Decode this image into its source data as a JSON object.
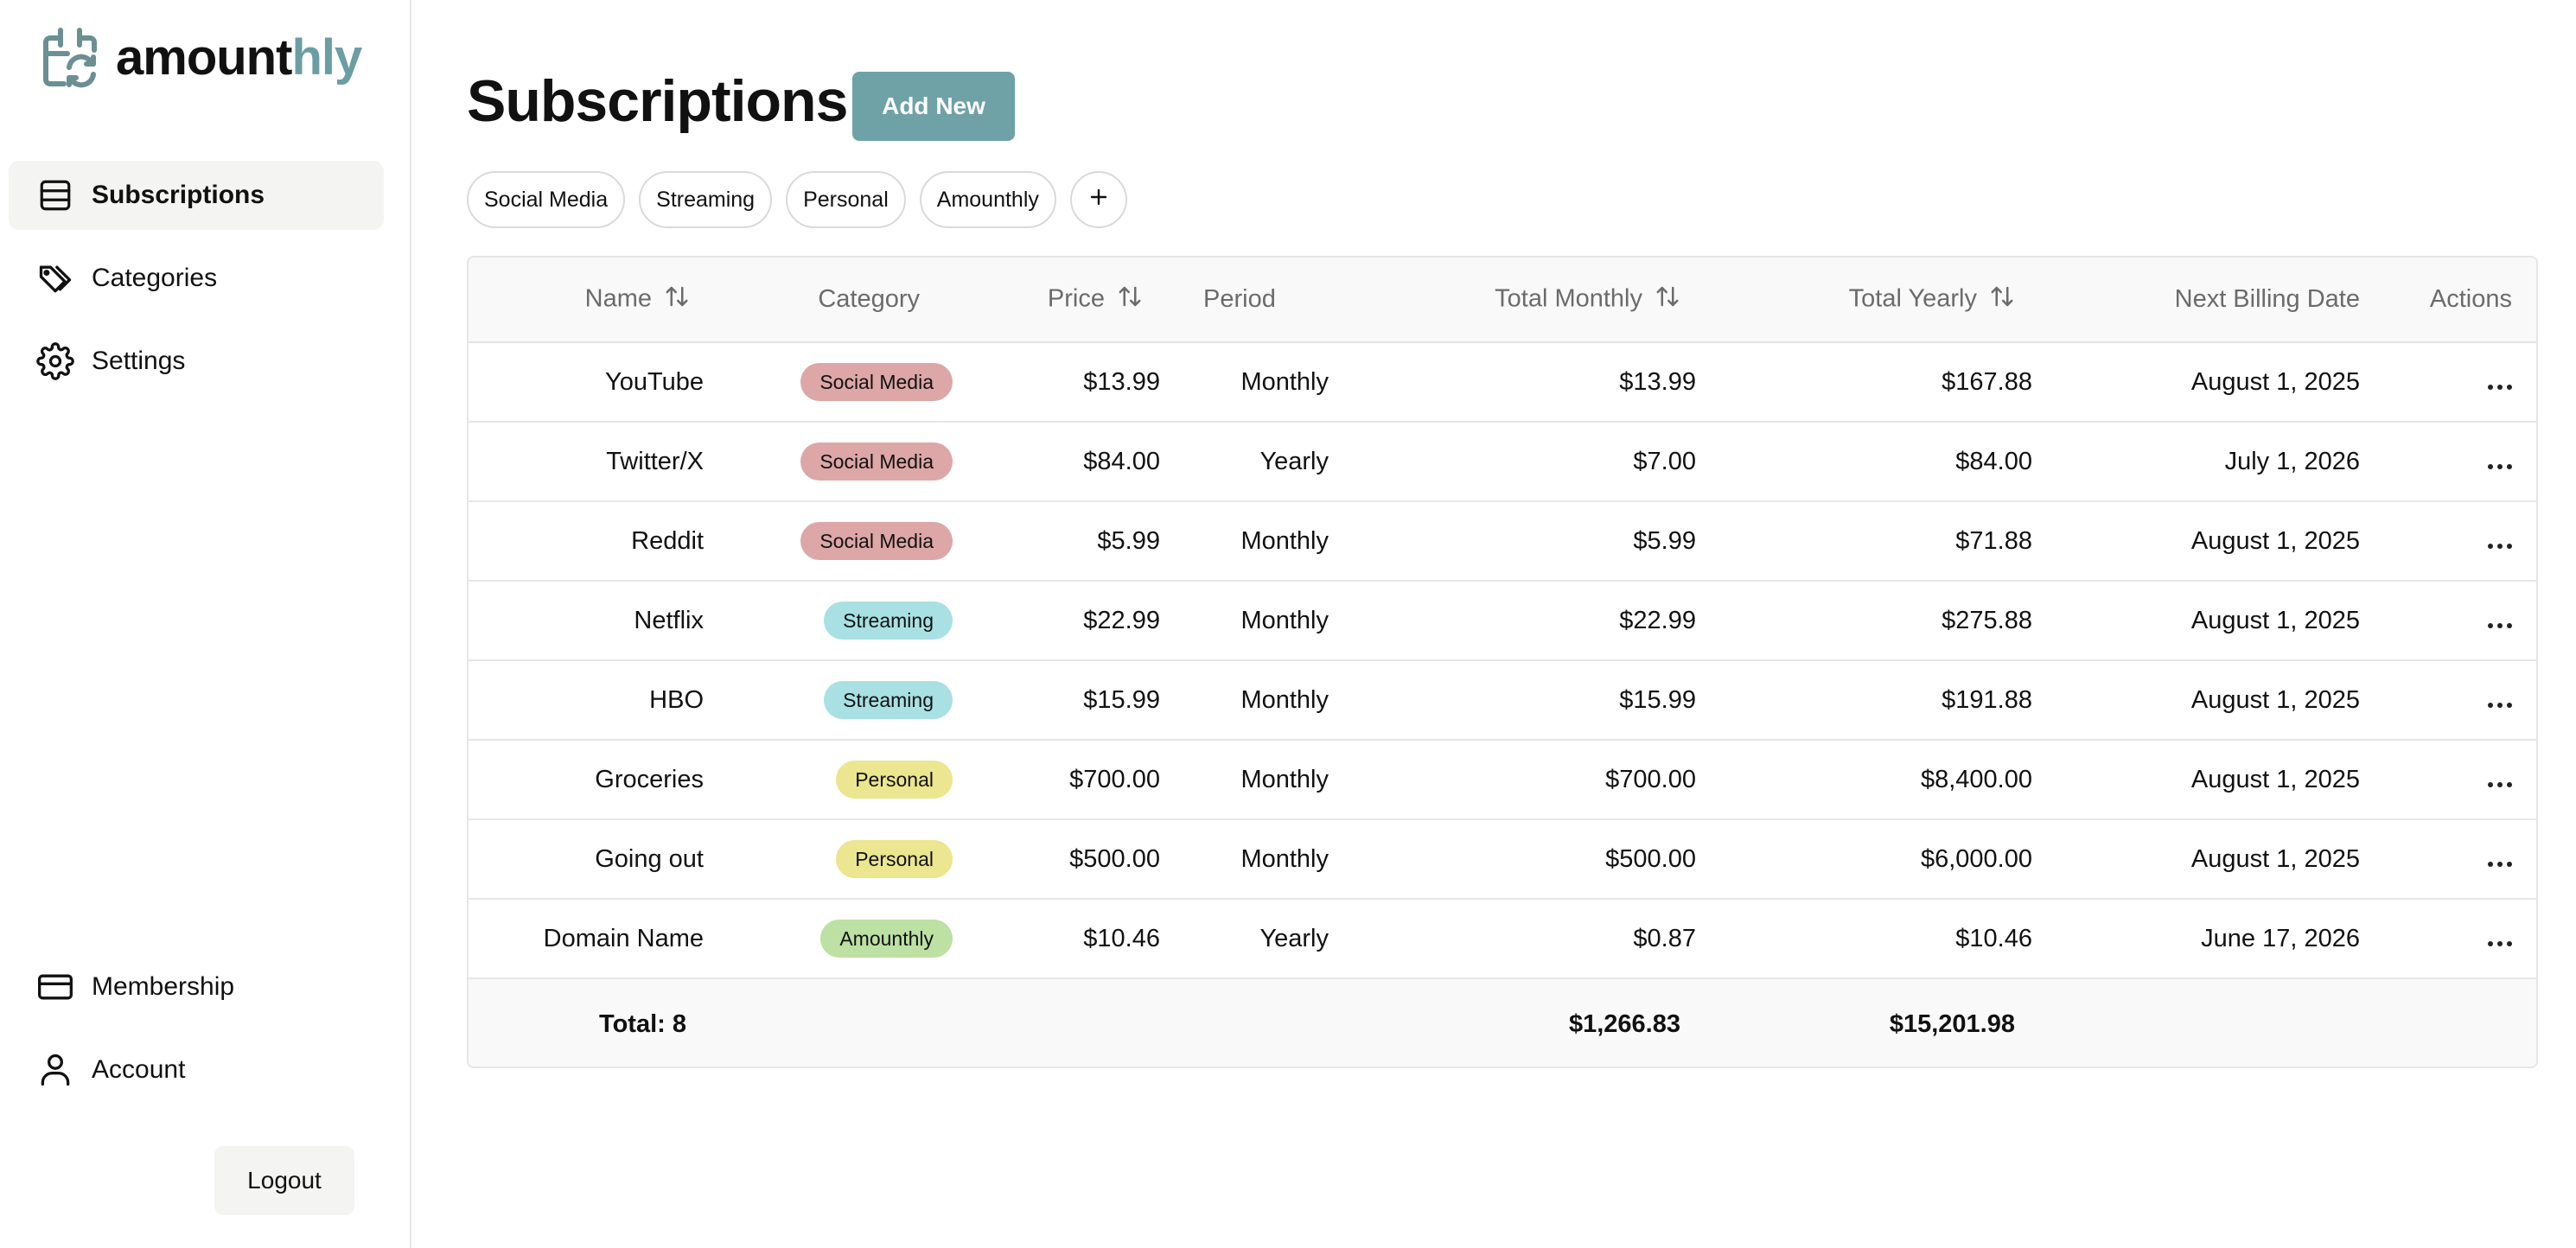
{
  "brand": {
    "name_main": "amount",
    "name_accent": "hly",
    "accent_color": "#6b9ea3"
  },
  "sidebar": {
    "items": [
      {
        "label": "Subscriptions",
        "icon": "list-icon",
        "active": true
      },
      {
        "label": "Categories",
        "icon": "tags-icon",
        "active": false
      },
      {
        "label": "Settings",
        "icon": "gear-icon",
        "active": false
      }
    ],
    "bottom_items": [
      {
        "label": "Membership",
        "icon": "credit-card-icon"
      },
      {
        "label": "Account",
        "icon": "user-icon"
      }
    ],
    "logout_label": "Logout"
  },
  "header": {
    "title": "Subscriptions",
    "add_label": "Add New",
    "add_color": "#6ea2a6"
  },
  "filters": [
    "Social Media",
    "Streaming",
    "Personal",
    "Amounthly"
  ],
  "filter_add_icon": "plus-icon",
  "table": {
    "columns": [
      "Name",
      "Category",
      "Price",
      "Period",
      "Total Monthly",
      "Total Yearly",
      "Next Billing Date",
      "Actions"
    ],
    "sortable": [
      "Name",
      "Price",
      "Total Monthly",
      "Total Yearly"
    ],
    "category_colors": {
      "Social Media": "#dda7a7",
      "Streaming": "#a8e0e4",
      "Personal": "#ebe68f",
      "Amounthly": "#bde0a3"
    },
    "rows": [
      {
        "name": "YouTube",
        "category": "Social Media",
        "price": "$13.99",
        "period": "Monthly",
        "total_monthly": "$13.99",
        "total_yearly": "$167.88",
        "next_billing": "August 1, 2025"
      },
      {
        "name": "Twitter/X",
        "category": "Social Media",
        "price": "$84.00",
        "period": "Yearly",
        "total_monthly": "$7.00",
        "total_yearly": "$84.00",
        "next_billing": "July 1, 2026"
      },
      {
        "name": "Reddit",
        "category": "Social Media",
        "price": "$5.99",
        "period": "Monthly",
        "total_monthly": "$5.99",
        "total_yearly": "$71.88",
        "next_billing": "August 1, 2025"
      },
      {
        "name": "Netflix",
        "category": "Streaming",
        "price": "$22.99",
        "period": "Monthly",
        "total_monthly": "$22.99",
        "total_yearly": "$275.88",
        "next_billing": "August 1, 2025"
      },
      {
        "name": "HBO",
        "category": "Streaming",
        "price": "$15.99",
        "period": "Monthly",
        "total_monthly": "$15.99",
        "total_yearly": "$191.88",
        "next_billing": "August 1, 2025"
      },
      {
        "name": "Groceries",
        "category": "Personal",
        "price": "$700.00",
        "period": "Monthly",
        "total_monthly": "$700.00",
        "total_yearly": "$8,400.00",
        "next_billing": "August 1, 2025"
      },
      {
        "name": "Going out",
        "category": "Personal",
        "price": "$500.00",
        "period": "Monthly",
        "total_monthly": "$500.00",
        "total_yearly": "$6,000.00",
        "next_billing": "August 1, 2025"
      },
      {
        "name": "Domain Name",
        "category": "Amounthly",
        "price": "$10.46",
        "period": "Yearly",
        "total_monthly": "$0.87",
        "total_yearly": "$10.46",
        "next_billing": "June 17, 2026"
      }
    ],
    "footer": {
      "total_label": "Total: 8",
      "total_monthly": "$1,266.83",
      "total_yearly": "$15,201.98"
    }
  }
}
